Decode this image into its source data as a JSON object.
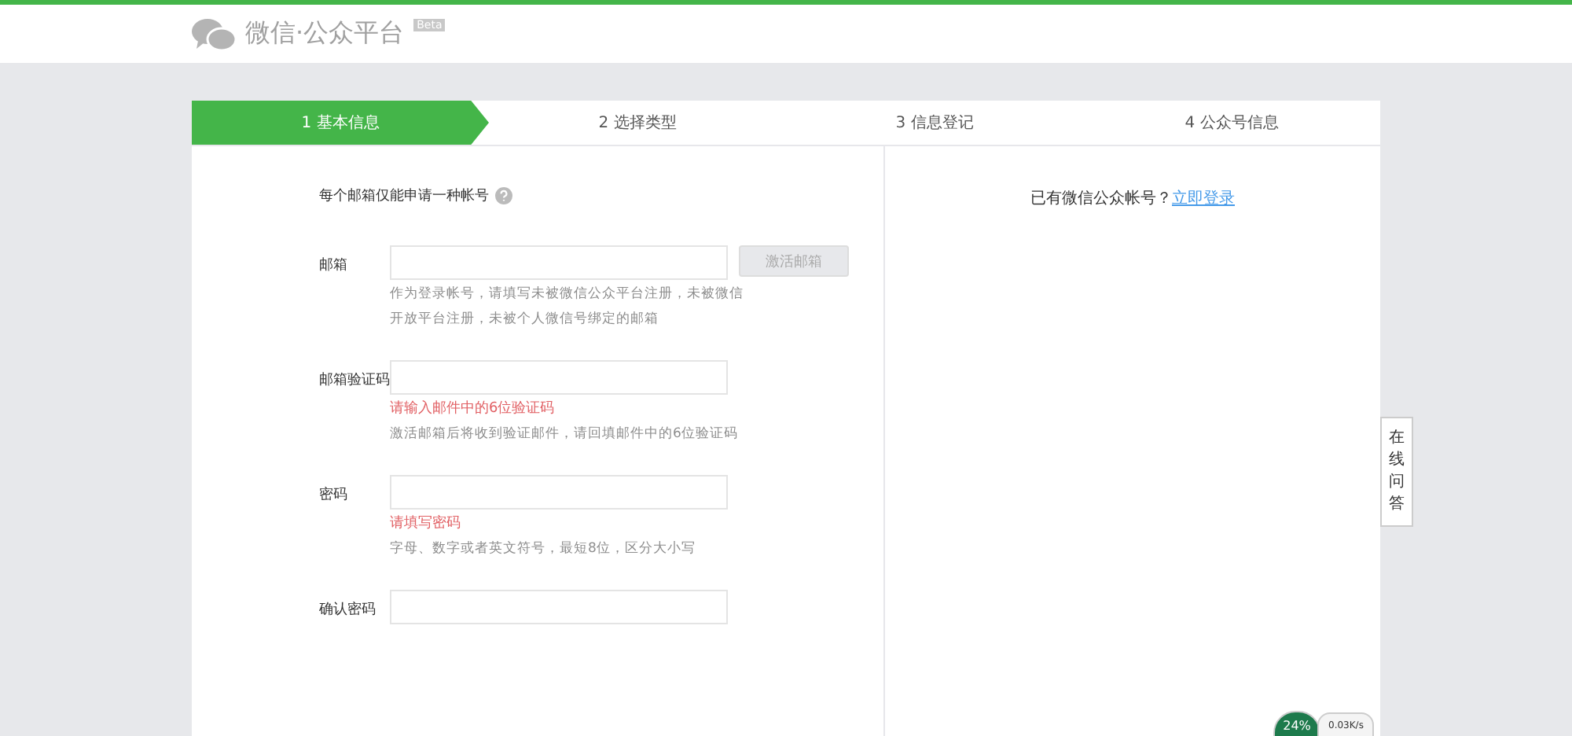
{
  "header": {
    "logo_text": "微信·公众平台",
    "badge": "Beta"
  },
  "steps": [
    {
      "label": "1 基本信息",
      "selected": true
    },
    {
      "label": "2 选择类型",
      "selected": false
    },
    {
      "label": "3 信息登记",
      "selected": false
    },
    {
      "label": "4 公众号信息",
      "selected": false
    }
  ],
  "form": {
    "intro": "每个邮箱仅能申请一种帐号",
    "fields": [
      {
        "label": "邮箱",
        "button": "激活邮箱",
        "hints": [
          "作为登录帐号，请填写未被微信公众平台注册，未被微信开放平台注册，未被个人微信号绑定的邮箱"
        ]
      },
      {
        "label": "邮箱验证码",
        "error": "请输入邮件中的6位验证码",
        "hints": [
          "激活邮箱后将收到验证邮件，请回填邮件中的6位验证码"
        ]
      },
      {
        "label": "密码",
        "error": "请填写密码",
        "hints": [
          "字母、数字或者英文符号，最短8位，区分大小写"
        ]
      },
      {
        "label": "确认密码"
      }
    ]
  },
  "side": {
    "text": "已有微信公众帐号？",
    "link": "立即登录"
  },
  "float_button": "在线问答",
  "speed_widget": {
    "percent": "24%",
    "speed": "0.03K/s"
  }
}
